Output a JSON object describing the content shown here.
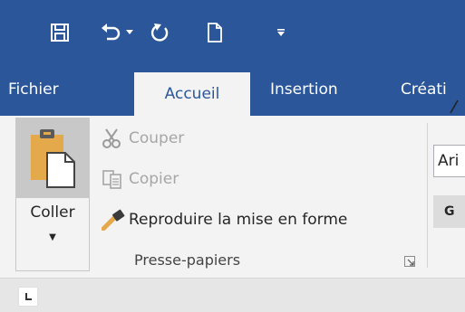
{
  "quick_access": {
    "icons": [
      "save-icon",
      "undo-icon",
      "undo-dropdown-icon",
      "redo-icon",
      "new-document-icon",
      "customize-quick-access-icon"
    ]
  },
  "tabs": [
    {
      "label": "Fichier"
    },
    {
      "label": "Accueil",
      "active": true
    },
    {
      "label": "Insertion"
    },
    {
      "label": "Créati"
    }
  ],
  "clipboard": {
    "paste_label": "Coller",
    "paste_arrow": "▼",
    "cut_label": "Couper",
    "copy_label": "Copier",
    "format_painter_label": "Reproduire la mise en forme",
    "group_label": "Presse-papiers"
  },
  "font": {
    "font_name": "Ari",
    "bold_label": "G"
  },
  "colors": {
    "title_bar": "#2b579a",
    "ribbon_bg": "#f3f3f3",
    "disabled_text": "#a6a6a6"
  }
}
